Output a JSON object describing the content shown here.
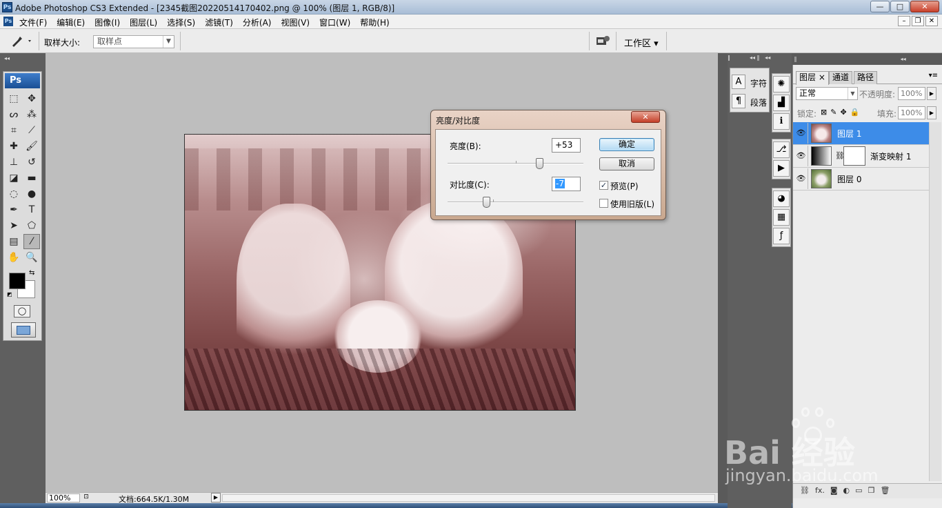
{
  "window": {
    "badge": "Ps",
    "title": "Adobe Photoshop CS3 Extended - [2345截图20220514170402.png @ 100% (图层 1, RGB/8)]",
    "buttons": {
      "minimize": "—",
      "maximize": "□",
      "close": "✕"
    }
  },
  "menubar": {
    "badge": "Ps",
    "items": [
      "文件(F)",
      "编辑(E)",
      "图像(I)",
      "图层(L)",
      "选择(S)",
      "滤镜(T)",
      "分析(A)",
      "视图(V)",
      "窗口(W)",
      "帮助(H)"
    ],
    "doc_buttons": {
      "minimize": "–",
      "restore": "❐",
      "close": "✕"
    }
  },
  "options": {
    "tool_icon": "eyedropper-icon",
    "sample_size_label": "取样大小:",
    "sample_size_value": "取样点",
    "workspace_label": "工作区 ▾"
  },
  "toolbox": {
    "header": "Ps",
    "tools": [
      {
        "name": "marquee",
        "glyph": "⬚"
      },
      {
        "name": "move",
        "glyph": "✥"
      },
      {
        "name": "lasso",
        "glyph": "ᔕ"
      },
      {
        "name": "magic-wand",
        "glyph": "⁂"
      },
      {
        "name": "crop",
        "glyph": "⌗"
      },
      {
        "name": "slice",
        "glyph": "⟋"
      },
      {
        "name": "healing",
        "glyph": "✚"
      },
      {
        "name": "brush",
        "glyph": "🖌"
      },
      {
        "name": "stamp",
        "glyph": "⊥"
      },
      {
        "name": "history-brush",
        "glyph": "↺"
      },
      {
        "name": "eraser",
        "glyph": "◪"
      },
      {
        "name": "gradient",
        "glyph": "▬"
      },
      {
        "name": "blur",
        "glyph": "◌"
      },
      {
        "name": "dodge",
        "glyph": "●"
      },
      {
        "name": "pen",
        "glyph": "✒"
      },
      {
        "name": "type",
        "glyph": "T"
      },
      {
        "name": "path-select",
        "glyph": "➤"
      },
      {
        "name": "shape",
        "glyph": "⬠"
      },
      {
        "name": "notes",
        "glyph": "▤"
      },
      {
        "name": "eyedropper",
        "glyph": "⁄"
      },
      {
        "name": "hand",
        "glyph": "✋"
      },
      {
        "name": "zoom",
        "glyph": "🔍"
      }
    ],
    "active_tool": "eyedropper",
    "swap_glyph": "⇆",
    "default_glyph": "◩",
    "quickmask_glyph": "◯"
  },
  "dialog": {
    "title": "亮度/对比度",
    "close": "✕",
    "brightness_label": "亮度(B):",
    "brightness_value": "+53",
    "contrast_label": "对比度(C):",
    "contrast_value": "-7",
    "ok": "确定",
    "cancel": "取消",
    "preview_label": "预览(P)",
    "preview_checked": true,
    "legacy_label": "使用旧版(L)",
    "legacy_checked": false,
    "brightness_slider": {
      "min": -150,
      "max": 150,
      "value": 53
    },
    "contrast_slider": {
      "min": -50,
      "max": 100,
      "value": -7
    }
  },
  "status": {
    "zoom": "100%",
    "doc": "文档:664.5K/1.30M",
    "arrow": "▶"
  },
  "char_panel": {
    "char_label": "字符",
    "para_label": "段落",
    "char_icon": "A",
    "para_icon": "¶"
  },
  "icon_strip": {
    "group1": [
      "✺",
      "▟",
      "ℹ"
    ],
    "group2": [
      "⎇",
      "▶"
    ],
    "group3": [
      "◕",
      "▦",
      "ƒ"
    ]
  },
  "layers": {
    "tabs": [
      "图层 ×",
      "通道",
      "路径"
    ],
    "blend_mode": "正常",
    "opacity_label": "不透明度:",
    "opacity_value": "100%",
    "lock_label": "锁定:",
    "fill_label": "填充:",
    "fill_value": "100%",
    "items": [
      {
        "name": "图层 1",
        "selected": true,
        "thumb": "pinkphoto"
      },
      {
        "name": "渐变映射 1",
        "selected": false,
        "thumb": "gradient"
      },
      {
        "name": "图层 0",
        "selected": false,
        "thumb": "colorphoto"
      }
    ],
    "eye": "👁",
    "chain": "⛓",
    "bottom_icons": [
      "⛓",
      "fx.",
      "◙",
      "◐",
      "▭",
      "❒",
      "🗑"
    ]
  },
  "watermark": {
    "brand": "Bai 经验",
    "url": "jingyan.baidu.com"
  }
}
